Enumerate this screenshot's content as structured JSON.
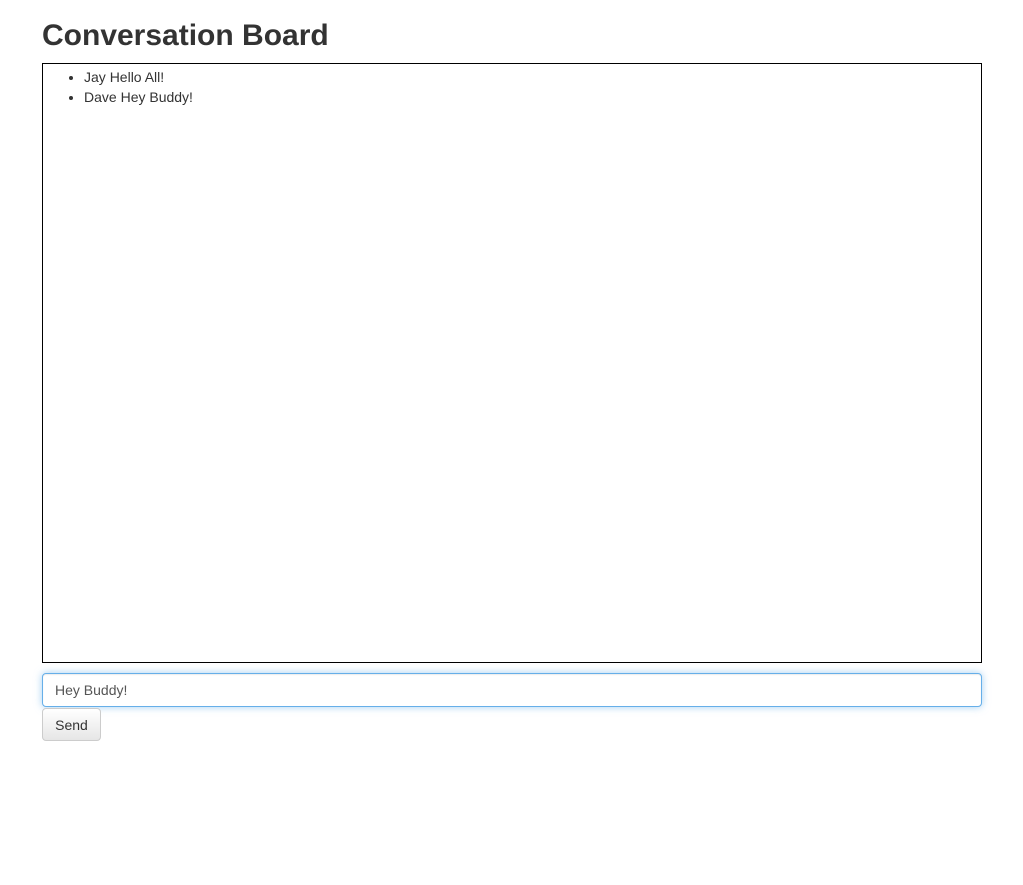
{
  "header": {
    "title": "Conversation Board"
  },
  "board": {
    "messages": [
      {
        "author": "Jay",
        "text": "Hello All!"
      },
      {
        "author": "Dave",
        "text": "Hey Buddy!"
      }
    ]
  },
  "composer": {
    "input_value": "Hey Buddy!",
    "send_label": "Send"
  },
  "colors": {
    "text": "#333333",
    "focus_border": "#66afe9",
    "board_border": "#000000"
  }
}
